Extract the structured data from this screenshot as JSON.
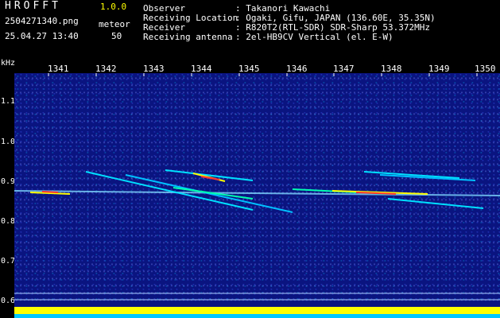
{
  "header": {
    "app_title": "HROFFT",
    "app_version": "1.0.0",
    "file_name": "2504271340.png",
    "timestamp": "25.04.27 13:40",
    "mode_label": "meteor",
    "mode_count": "50"
  },
  "info": [
    {
      "key": "Observer",
      "value": ": Takanori Kawachi"
    },
    {
      "key": "Receiving Location",
      "value": ": Ogaki, Gifu, JAPAN (136.60E, 35.35N)"
    },
    {
      "key": "Receiver",
      "value": ": R820T2(RTL-SDR) SDR-Sharp 53.372MHz"
    },
    {
      "key": "Receiving antenna",
      "value": ": 2el-HB9CV Vertical (el. E-W)"
    }
  ],
  "axis": {
    "y_unit": "kHz",
    "y_ticks": [
      "1.1",
      "1.0",
      "0.9",
      "0.8",
      "0.7",
      "0.6"
    ],
    "x_ticks": [
      "1341",
      "1342",
      "1343",
      "1344",
      "1345",
      "1346",
      "1347",
      "1348",
      "1349",
      "1350"
    ]
  },
  "colors": {
    "background": "#000000",
    "waterfall": "#0a1480",
    "trail_cyan": "#00e0ff",
    "trail_yellow": "#ffff00",
    "trail_red": "#ff3030",
    "level_yellow": "#ffff00",
    "level_cyan": "#00c8ff"
  }
}
